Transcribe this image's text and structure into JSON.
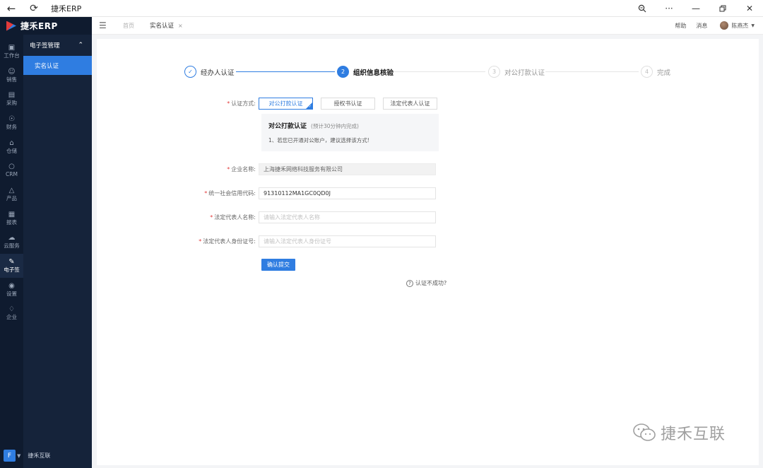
{
  "window": {
    "title": "捷禾ERP",
    "icons": {
      "back": "back-arrow-icon",
      "refresh": "refresh-icon",
      "zoom": "zoom-icon",
      "more": "more-icon",
      "minimize": "minimize-icon",
      "restore": "restore-icon",
      "close": "close-icon"
    }
  },
  "brand": {
    "name": "捷禾ERP"
  },
  "nav": {
    "items": [
      {
        "label": "工作台",
        "icon": "monitor-icon"
      },
      {
        "label": "销售",
        "icon": "sales-icon"
      },
      {
        "label": "采购",
        "icon": "purchase-icon"
      },
      {
        "label": "财务",
        "icon": "finance-icon"
      },
      {
        "label": "仓储",
        "icon": "warehouse-icon"
      },
      {
        "label": "CRM",
        "icon": "crm-icon"
      },
      {
        "label": "产品",
        "icon": "product-icon"
      },
      {
        "label": "报表",
        "icon": "report-icon"
      },
      {
        "label": "云服务",
        "icon": "cloud-icon"
      },
      {
        "label": "电子签",
        "icon": "esign-icon"
      },
      {
        "label": "设置",
        "icon": "settings-icon"
      },
      {
        "label": "企业",
        "icon": "enterprise-icon"
      }
    ],
    "active_index": 9
  },
  "sidebar_bottom": {
    "avatar_letter": "F",
    "company": "捷禾互联"
  },
  "submenu": {
    "title": "电子签管理",
    "items": [
      {
        "label": "实名认证"
      }
    ]
  },
  "header": {
    "home": "首页",
    "tab": "实名认证",
    "links": {
      "help": "帮助",
      "notice": "消息"
    },
    "user": "陈燕杰"
  },
  "steps": [
    {
      "num": "1",
      "label": "经办人认证",
      "status": "done"
    },
    {
      "num": "2",
      "label": "组织信息核验",
      "status": "active"
    },
    {
      "num": "3",
      "label": "对公打款认证",
      "status": "wait"
    },
    {
      "num": "4",
      "label": "完成",
      "status": "wait"
    }
  ],
  "form": {
    "method": {
      "label": "认证方式:",
      "options": [
        "对公打款认证",
        "授权书认证",
        "法定代表人认证"
      ],
      "selected": 0
    },
    "info": {
      "title": "对公打款认证",
      "sub": "(预计30分钟内完成)",
      "desc": "1、若您已开通对公账户，建议选择该方式!"
    },
    "company_name": {
      "label": "企业名称:",
      "value": "上海捷禾网络科技服务有限公司"
    },
    "credit_code": {
      "label": "统一社会信用代码:",
      "value": "91310112MA1GC0QD0J"
    },
    "legal_rep_name": {
      "label": "法定代表人名称:",
      "placeholder": "请输入法定代表人名称"
    },
    "legal_rep_id": {
      "label": "法定代表人身份证号:",
      "placeholder": "请输入法定代表人身份证号"
    },
    "submit": "确认提交",
    "help": "认证不成功?"
  },
  "watermark": {
    "text": "捷禾互联"
  },
  "colors": {
    "accent": "#2f7de1",
    "sidebar": "#0f1b2f",
    "submenu": "#15233a"
  }
}
